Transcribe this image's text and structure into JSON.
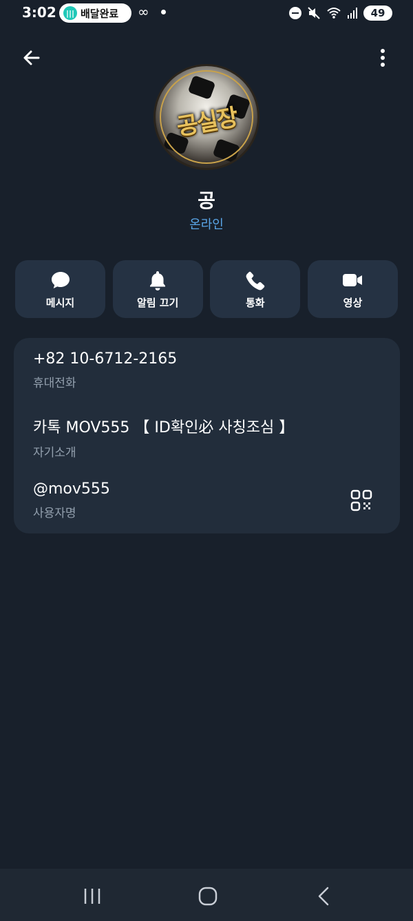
{
  "status_bar": {
    "time": "3:02",
    "delivery_badge": "배달완료",
    "battery": "49",
    "icons": [
      "infinity-icon",
      "dnd-icon",
      "mute-icon",
      "wifi-icon",
      "signal-icon",
      "battery-icon"
    ]
  },
  "header": {
    "back_icon": "arrow-left-icon",
    "menu_icon": "more-vertical-icon"
  },
  "profile": {
    "avatar_text": "공실장",
    "name": "공",
    "status": "온라인",
    "status_color": "#5aa6e8"
  },
  "actions": [
    {
      "label": "메시지",
      "icon": "chat-bubble-icon"
    },
    {
      "label": "알림 끄기",
      "icon": "bell-icon"
    },
    {
      "label": "통화",
      "icon": "phone-icon"
    },
    {
      "label": "영상",
      "icon": "video-icon"
    }
  ],
  "info": {
    "phone": {
      "value": "+82 10-6712-2165",
      "label": "휴대전화"
    },
    "bio": {
      "value": "카톡 MOV555 【 ID확인必 사칭조심 】",
      "label": "자기소개"
    },
    "username": {
      "value": "@mov555",
      "label": "사용자명",
      "action_icon": "qr-code-icon"
    }
  },
  "navigation": {
    "buttons": [
      "recent-apps-icon",
      "home-icon",
      "back-icon"
    ]
  },
  "colors": {
    "background": "#18202b",
    "card": "#222d3b",
    "button": "#253243",
    "accent": "#5aa6e8"
  }
}
